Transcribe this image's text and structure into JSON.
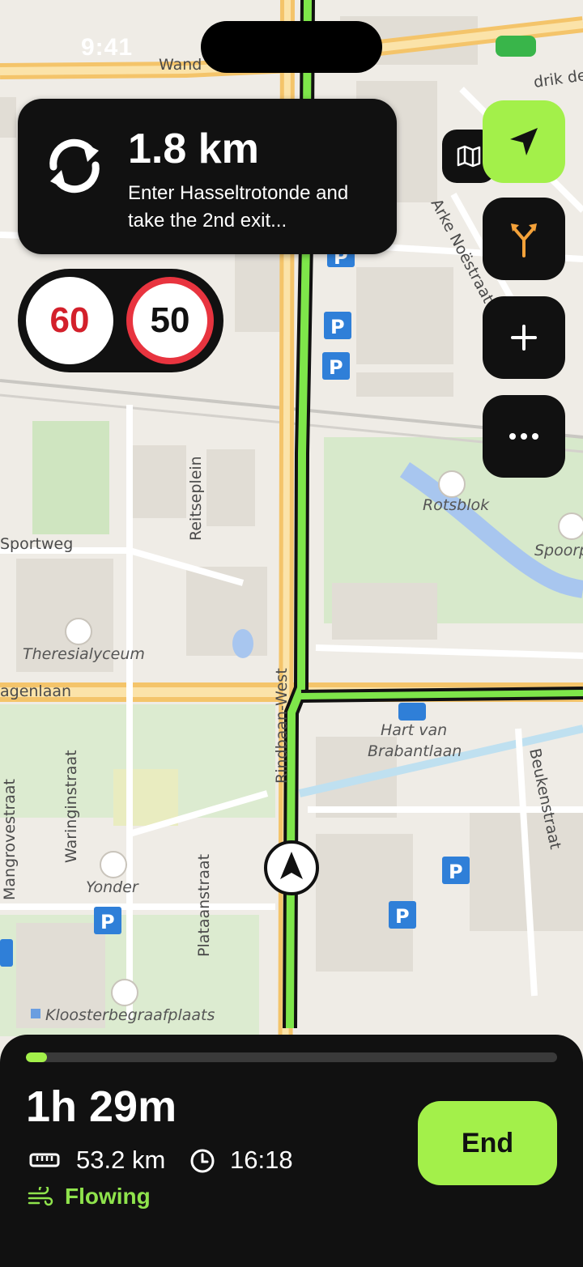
{
  "status_bar": {
    "time": "9:41"
  },
  "map": {
    "streets": [
      "Wand",
      "Arke Noëstraat",
      "Reitseplein",
      "Sportweg",
      "agenlaan",
      "Rindbaan-West",
      "Waringinstraat",
      "Mangrovestraat",
      "Plataanstraat",
      "Beukenstraat",
      "drik de"
    ],
    "pois": [
      "Rotsblok",
      "Spoorp",
      "Theresialyceum",
      "Hart van\nBrabantlaan",
      "Yonder",
      "Kloosterbegraafplaats"
    ],
    "route_color": "#7ee64a"
  },
  "navigation": {
    "maneuver_icon": "roundabout-icon",
    "distance": "1.8 km",
    "instruction": "Enter Hasseltrotonde and take the 2nd exit..."
  },
  "speed": {
    "current": "60",
    "limit": "50"
  },
  "controls": {
    "recenter_icon": "location-arrow-icon",
    "map_mode_icon": "map-icon",
    "routes_icon": "fork-icon",
    "zoom_icon": "plus-icon",
    "more_icon": "ellipsis-icon",
    "accent": "#a3f04a"
  },
  "trip": {
    "progress": 0.04,
    "duration": "1h 29m",
    "remaining_distance": "53.2 km",
    "arrival_time": "16:18",
    "traffic_status": "Flowing",
    "end_label": "End"
  }
}
